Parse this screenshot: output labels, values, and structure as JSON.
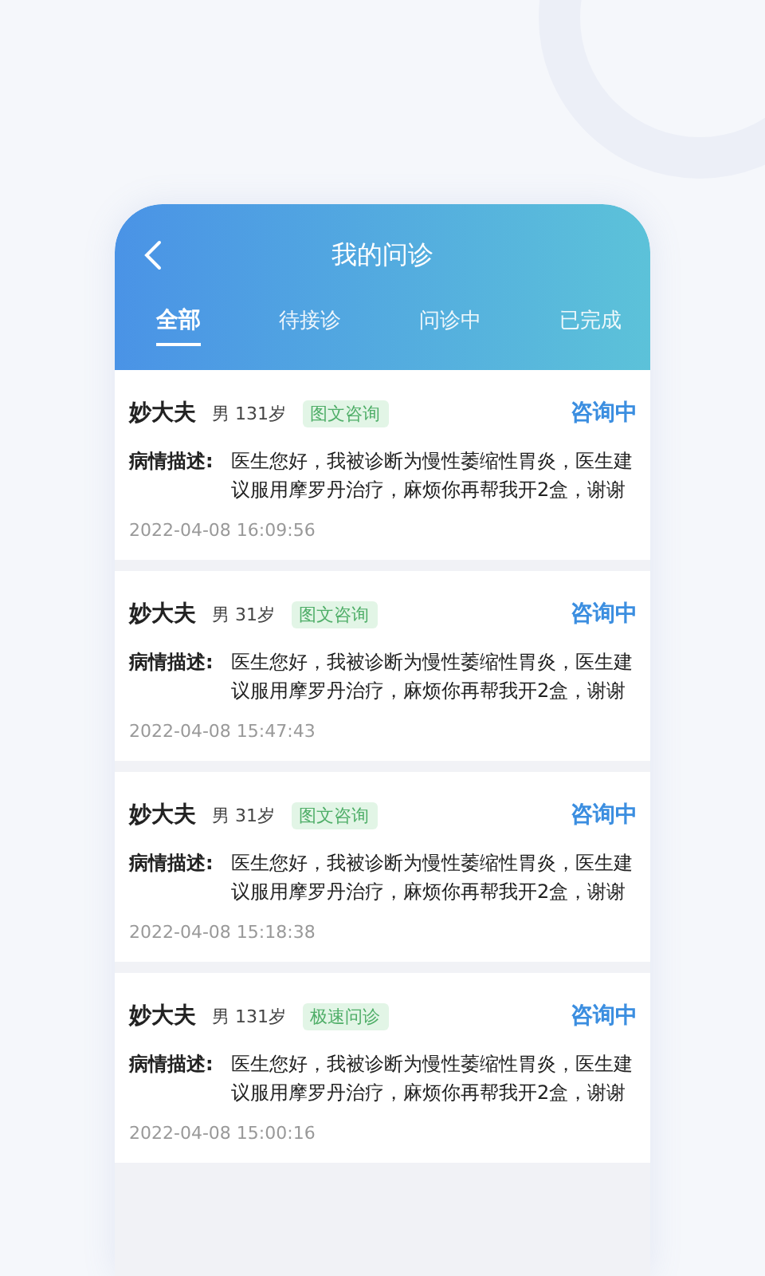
{
  "header": {
    "title": "我的问诊"
  },
  "tabs": [
    {
      "label": "全部",
      "selected": true
    },
    {
      "label": "待接诊",
      "selected": false
    },
    {
      "label": "问诊中",
      "selected": false
    },
    {
      "label": "已完成",
      "selected": false
    }
  ],
  "consultations": [
    {
      "doctor": "妙大夫",
      "patient": "男 131岁",
      "tag": "图文咨询",
      "status": "咨询中",
      "desc_label": "病情描述:",
      "desc": "医生您好，我被诊断为慢性萎缩性胃炎，医生建议服用摩罗丹治疗，麻烦你再帮我开2盒，谢谢",
      "time": "2022-04-08 16:09:56"
    },
    {
      "doctor": "妙大夫",
      "patient": "男 31岁",
      "tag": "图文咨询",
      "status": "咨询中",
      "desc_label": "病情描述:",
      "desc": "医生您好，我被诊断为慢性萎缩性胃炎，医生建议服用摩罗丹治疗，麻烦你再帮我开2盒，谢谢",
      "time": "2022-04-08 15:47:43"
    },
    {
      "doctor": "妙大夫",
      "patient": "男 31岁",
      "tag": "图文咨询",
      "status": "咨询中",
      "desc_label": "病情描述:",
      "desc": "医生您好，我被诊断为慢性萎缩性胃炎，医生建议服用摩罗丹治疗，麻烦你再帮我开2盒，谢谢",
      "time": "2022-04-08 15:18:38"
    },
    {
      "doctor": "妙大夫",
      "patient": "男 131岁",
      "tag": "极速问诊",
      "status": "咨询中",
      "desc_label": "病情描述:",
      "desc": "医生您好，我被诊断为慢性萎缩性胃炎，医生建议服用摩罗丹治疗，麻烦你再帮我开2盒，谢谢",
      "time": "2022-04-08 15:00:16"
    }
  ]
}
